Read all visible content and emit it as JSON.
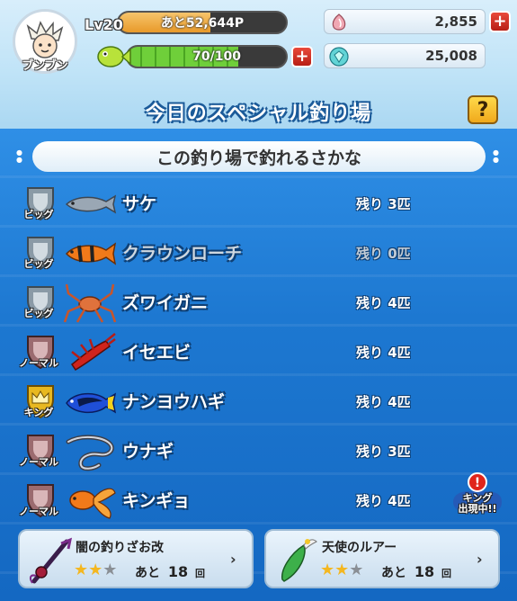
{
  "header": {
    "player_name": "ブンブン",
    "level_label": "Lv20",
    "exp_text": "あと52,644P",
    "stamina_text": "70/100",
    "stamina_fraction": 0.7,
    "exp_fraction": 0.55,
    "currency_1": "2,855",
    "currency_2": "25,008"
  },
  "banner": {
    "title": "今日のスペシャル釣り場",
    "help": "?"
  },
  "section": {
    "title": "この釣り場で釣れるさかな"
  },
  "fish": [
    {
      "rank": "ビッグ",
      "name": "サケ",
      "remaining": "残り 3匹",
      "available": true,
      "icon": "salmon-icon"
    },
    {
      "rank": "ビッグ",
      "name": "クラウンローチ",
      "remaining": "残り 0匹",
      "available": false,
      "icon": "clown-loach-icon"
    },
    {
      "rank": "ビッグ",
      "name": "ズワイガニ",
      "remaining": "残り 4匹",
      "available": true,
      "icon": "snow-crab-icon"
    },
    {
      "rank": "ノーマル",
      "name": "イセエビ",
      "remaining": "残り 4匹",
      "available": true,
      "icon": "spiny-lobster-icon"
    },
    {
      "rank": "キング",
      "name": "ナンヨウハギ",
      "remaining": "残り 4匹",
      "available": true,
      "icon": "blue-tang-icon"
    },
    {
      "rank": "ノーマル",
      "name": "ウナギ",
      "remaining": "残り 3匹",
      "available": true,
      "icon": "eel-icon"
    },
    {
      "rank": "ノーマル",
      "name": "キンギョ",
      "remaining": "残り 4匹",
      "available": true,
      "icon": "goldfish-icon"
    }
  ],
  "king_alert": {
    "mark": "!",
    "line1": "キング",
    "line2": "出現中!!"
  },
  "equipment": [
    {
      "name": "闇の釣りざお改",
      "count_prefix": "あと",
      "count": "18",
      "count_suffix": "回",
      "stars": 2,
      "max_stars": 3
    },
    {
      "name": "天使のルアー",
      "count_prefix": "あと",
      "count": "18",
      "count_suffix": "回",
      "stars": 2,
      "max_stars": 3
    }
  ],
  "colors": {
    "rank_big": "#8a9aa6",
    "rank_normal": "#9b6b6f",
    "rank_king": "#e8b820"
  }
}
